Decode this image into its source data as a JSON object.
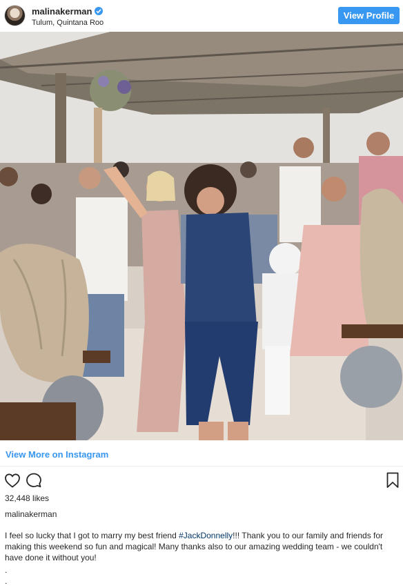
{
  "post": {
    "username": "malinakerman",
    "location": "Tulum, Quintana Roo",
    "view_profile_label": "View Profile",
    "view_more_label": "View More on Instagram",
    "likes": "32,448 likes",
    "caption_username": "malinakerman",
    "caption_before": "I feel so lucky that I got to marry my best friend ",
    "caption_hashtag": "#JackDonnelly",
    "caption_after": "!!! Thank you to our family and friends for making this weekend so fun and magical!  Many thanks also to our amazing wedding team - we couldn't have done it without you!",
    "caption_dots": ".\n."
  },
  "icons": {
    "verified": "verified-badge-icon",
    "like": "heart-icon",
    "comment": "comment-bubble-icon",
    "save": "bookmark-icon"
  },
  "colors": {
    "accent": "#3897f0",
    "hashtag": "#003569",
    "text": "#262626"
  }
}
